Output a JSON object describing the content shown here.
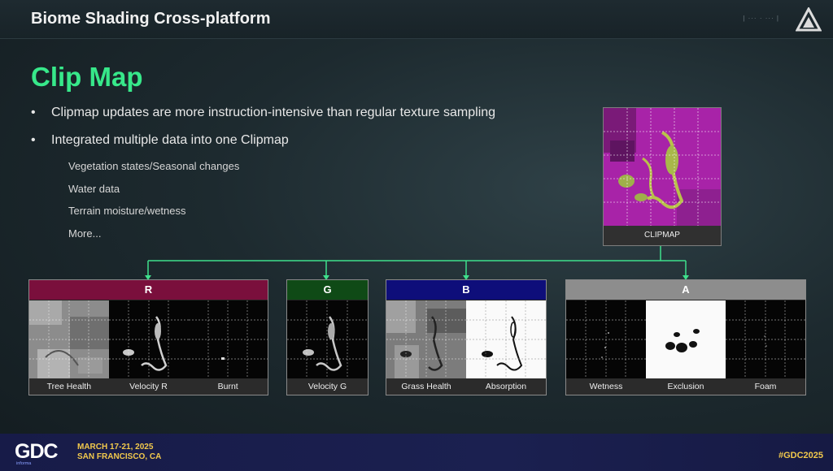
{
  "header": {
    "title": "Biome Shading Cross-platform",
    "crumbs": "| ··· · ··· |"
  },
  "slide": {
    "heading": "Clip Map",
    "bullet_glyph": "•",
    "bullets": [
      "Clipmap updates are more instruction-intensive than regular texture sampling",
      "Integrated multiple data into one Clipmap"
    ],
    "subitems": [
      "Vegetation states/Seasonal changes",
      "Water data",
      "Terrain moisture/wetness",
      "More..."
    ]
  },
  "clipmap": {
    "caption": "CLIPMAP",
    "color": "#b327b3"
  },
  "channels": [
    {
      "name": "R",
      "color": "#7a0f3c",
      "labels": [
        "Tree Health",
        "Velocity R",
        "Burnt"
      ]
    },
    {
      "name": "G",
      "color": "#0f4a16",
      "labels": [
        "Velocity G"
      ]
    },
    {
      "name": "B",
      "color": "#0e0e7a",
      "labels": [
        "Grass Health",
        "Absorption"
      ]
    },
    {
      "name": "A",
      "color": "#8d8d8d",
      "labels": [
        "Wetness",
        "Exclusion",
        "Foam"
      ]
    }
  ],
  "connector_color": "#3fe08c",
  "footer": {
    "logo": "GDC",
    "date_line1": "MARCH 17-21, 2025",
    "date_line2": "SAN FRANCISCO, CA",
    "hashtag": "#GDC2025",
    "small": "informa"
  }
}
